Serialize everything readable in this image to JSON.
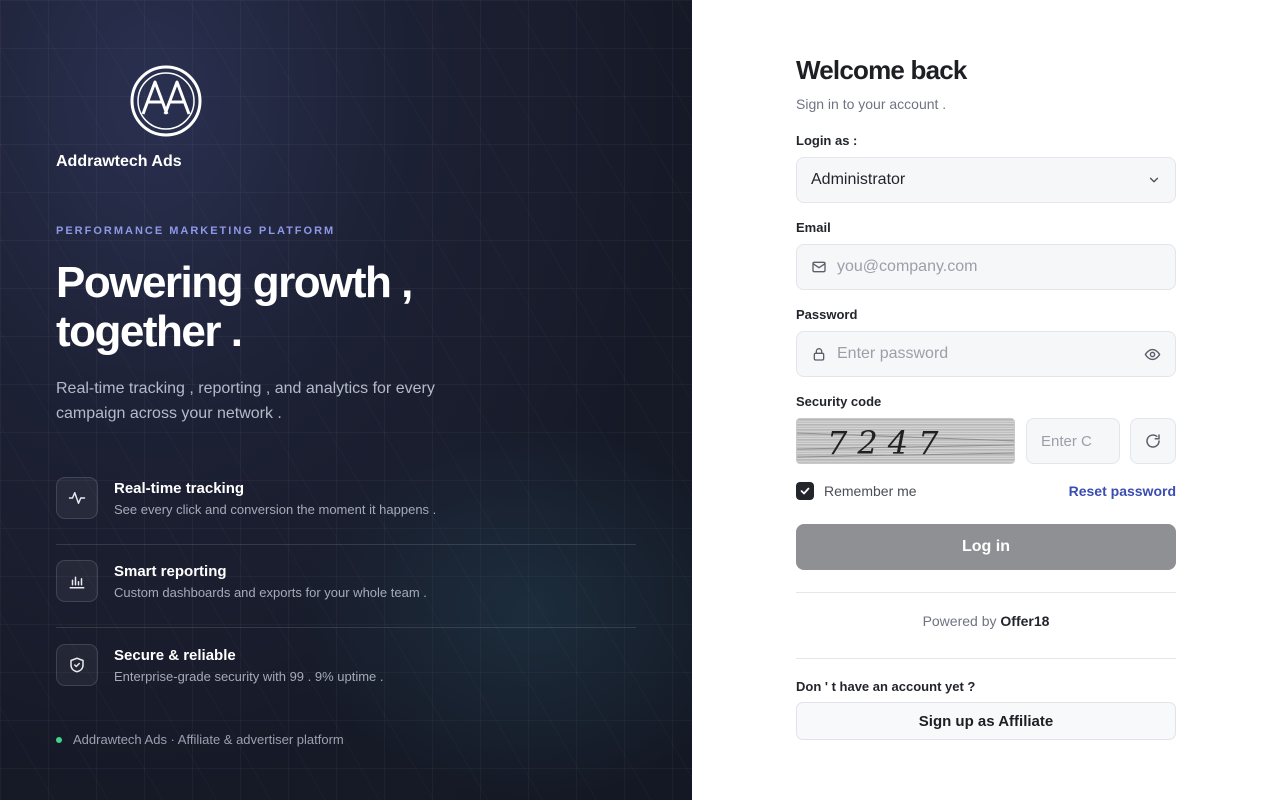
{
  "brand": {
    "name": "Addrawtech Ads",
    "logo_letters": "AA",
    "icon": "circle-monogram-logo"
  },
  "hero": {
    "kicker": "PERFORMANCE MARKETING PLATFORM",
    "headline_line1": "Powering growth ,",
    "headline_line2": "together .",
    "subtitle": "Real-time tracking , reporting , and analytics for every campaign across your network ."
  },
  "features": [
    {
      "title": "Real-time tracking",
      "description": "See every click and conversion the moment it happens .",
      "icon": "activity-pulse-icon"
    },
    {
      "title": "Smart reporting",
      "description": "Custom dashboards and exports for your whole team .",
      "icon": "bar-chart-icon"
    },
    {
      "title": "Secure & reliable",
      "description": "Enterprise-grade security with 99 . 9% uptime .",
      "icon": "shield-check-icon"
    }
  ],
  "left_footer": "Addrawtech Ads · Affiliate & advertiser platform",
  "colors": {
    "accent_kicker": "#8e98e6",
    "status_dot": "#3dd68c",
    "link": "#3a4db0",
    "login_button": "#8f9093"
  },
  "form": {
    "title": "Welcome back",
    "subtitle": "Sign in to your account .",
    "login_as_label": "Login as :",
    "login_as_value": "Administrator",
    "email_label": "Email",
    "email_placeholder": "you@company.com",
    "password_label": "Password",
    "password_placeholder": "Enter password",
    "security_label": "Security code",
    "captcha_text": "7247",
    "code_placeholder": "Enter C",
    "remember_label": "Remember me",
    "remember_checked": true,
    "reset_label": "Reset password",
    "login_label": "Log in",
    "powered_prefix": "Powered by",
    "powered_brand": "Offer18",
    "no_account": "Don ' t have an account yet ?",
    "signup_label": "Sign up as Affiliate"
  }
}
